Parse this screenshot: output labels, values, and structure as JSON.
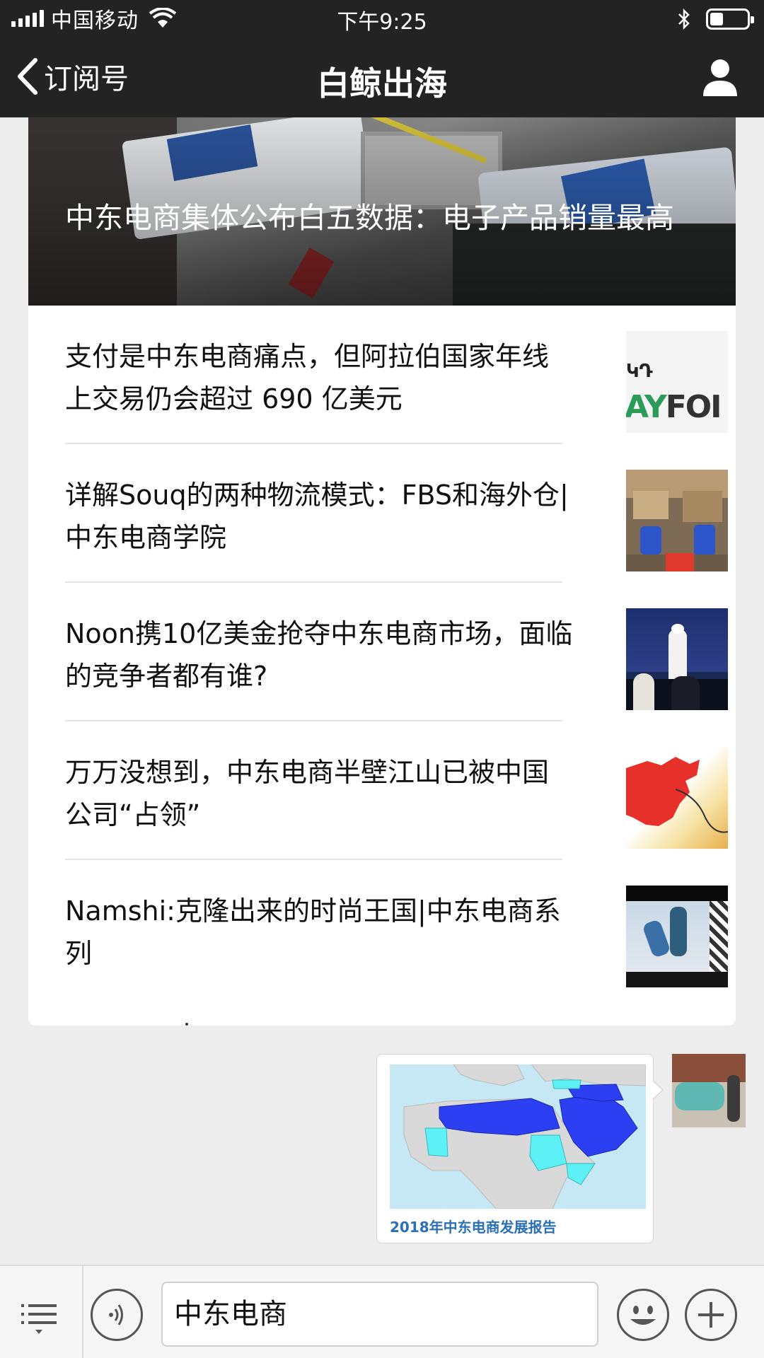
{
  "status_bar": {
    "carrier": "中国移动",
    "time": "下午9:25",
    "battery_level": 0.35
  },
  "nav": {
    "back_label": "订阅号",
    "title": "白鲸出海",
    "profile_icon": "person-icon"
  },
  "articles": {
    "hero_title": "中东电商集体公布白五数据：电子产品销量最高",
    "items": [
      {
        "title": "支付是中东电商痛点，但阿拉伯国家年线上交易仍会超过 690 亿美元",
        "thumb": "payfort-logo"
      },
      {
        "title": "详解Souq的两种物流模式：FBS和海外仓|中东电商学院",
        "thumb": "warehouse-photo"
      },
      {
        "title": "Noon携10亿美金抢夺中东电商市场，面临的竞争者都有谁?",
        "thumb": "stage-presentation-photo"
      },
      {
        "title": "万万没想到，中东电商半壁江山已被中国公司“占领”",
        "thumb": "china-map-image"
      },
      {
        "title": "Namshi:克隆出来的时尚王国|中东电商系列",
        "thumb": "fashion-photo"
      }
    ]
  },
  "thumb_text": {
    "logo_mark": "ԿԴ",
    "word_green": "AY",
    "word_dark": "FOI"
  },
  "message": {
    "caption": "2018年中东电商发展报告",
    "image": "middle-east-map"
  },
  "input": {
    "value": "中东电商",
    "menu_icon": "menu-list-icon",
    "voice_icon": "voice-icon",
    "emoji_icon": "emoji-icon",
    "plus_icon": "plus-icon"
  },
  "colors": {
    "bar_bg": "#232323",
    "caption_blue": "#2a70b6",
    "map_water": "#c6e8f5",
    "map_highlight": "#2d3ff2",
    "map_light": "#5df0f5"
  }
}
